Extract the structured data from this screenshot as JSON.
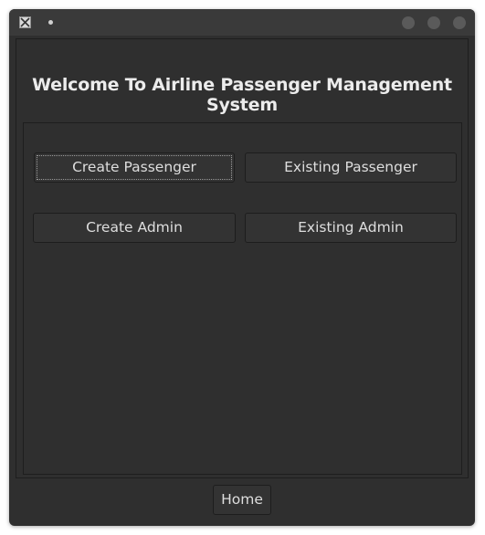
{
  "window": {
    "title_indicator": "•"
  },
  "main": {
    "heading": "Welcome To Airline Passenger Management System",
    "buttons": {
      "create_passenger": "Create Passenger",
      "existing_passenger": "Existing Passenger",
      "create_admin": "Create Admin",
      "existing_admin": "Existing Admin"
    }
  },
  "footer": {
    "home_label": "Home"
  },
  "icons": {
    "app": "x11-app-icon",
    "window_controls": [
      "minimize-icon",
      "maximize-icon",
      "close-icon"
    ]
  },
  "colors": {
    "background": "#2f2f2f",
    "titlebar": "#3a3a3a",
    "button": "#333333",
    "text": "#dedede"
  }
}
